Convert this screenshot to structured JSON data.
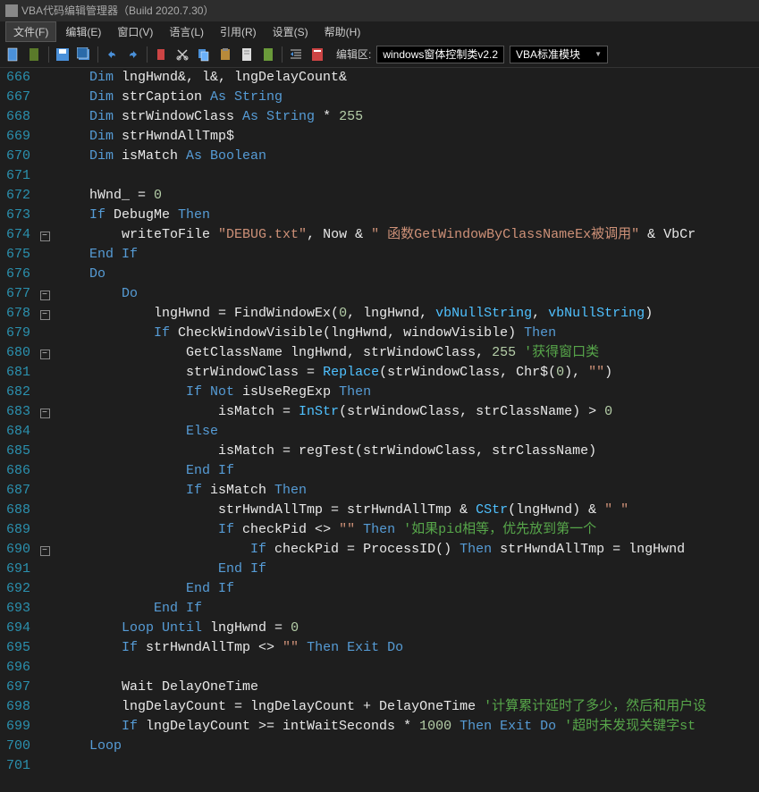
{
  "title": "VBA代码编辑管理器（Build 2020.7.30）",
  "menu": {
    "file": "文件(F)",
    "edit": "编辑(E)",
    "window": "窗口(V)",
    "language": "语言(L)",
    "reference": "引用(R)",
    "settings": "设置(S)",
    "help": "帮助(H)"
  },
  "toolbar": {
    "editarea_label": "编辑区:",
    "combo1": "windows窗体控制类v2.2",
    "combo2": "VBA标准模块"
  },
  "lines": [
    "666",
    "667",
    "668",
    "669",
    "670",
    "671",
    "672",
    "673",
    "674",
    "675",
    "676",
    "677",
    "678",
    "679",
    "680",
    "681",
    "682",
    "683",
    "684",
    "685",
    "686",
    "687",
    "688",
    "689",
    "690",
    "691",
    "692",
    "693",
    "694",
    "695",
    "696",
    "697",
    "698",
    "699",
    "700",
    "701"
  ],
  "code": [
    [
      [
        "kw",
        "    Dim"
      ],
      [
        "id",
        " lngHwnd&, l&, lngDelayCount&"
      ]
    ],
    [
      [
        "kw",
        "    Dim"
      ],
      [
        "id",
        " strCaption "
      ],
      [
        "kw",
        "As String"
      ]
    ],
    [
      [
        "kw",
        "    Dim"
      ],
      [
        "id",
        " strWindowClass "
      ],
      [
        "kw",
        "As String"
      ],
      [
        "op",
        " * "
      ],
      [
        "num",
        "255"
      ]
    ],
    [
      [
        "kw",
        "    Dim"
      ],
      [
        "id",
        " strHwndAllTmp$"
      ]
    ],
    [
      [
        "kw",
        "    Dim"
      ],
      [
        "id",
        " isMatch "
      ],
      [
        "kw",
        "As Boolean"
      ]
    ],
    [
      [
        "id",
        ""
      ]
    ],
    [
      [
        "id",
        "    hWnd_ = "
      ],
      [
        "num",
        "0"
      ]
    ],
    [
      [
        "kw",
        "    If"
      ],
      [
        "id",
        " DebugMe "
      ],
      [
        "kw",
        "Then"
      ]
    ],
    [
      [
        "id",
        "        writeToFile "
      ],
      [
        "str",
        "\"DEBUG.txt\""
      ],
      [
        "id",
        ", Now & "
      ],
      [
        "str",
        "\" 函数GetWindowByClassNameEx被调用\""
      ],
      [
        "id",
        " & VbCr"
      ]
    ],
    [
      [
        "kw",
        "    End If"
      ]
    ],
    [
      [
        "kw",
        "    Do"
      ]
    ],
    [
      [
        "kw",
        "        Do"
      ]
    ],
    [
      [
        "id",
        "            lngHwnd = FindWindowEx("
      ],
      [
        "num",
        "0"
      ],
      [
        "id",
        ", lngHwnd, "
      ],
      [
        "fn",
        "vbNullString"
      ],
      [
        "id",
        ", "
      ],
      [
        "fn",
        "vbNullString"
      ],
      [
        "id",
        ")"
      ]
    ],
    [
      [
        "kw",
        "            If"
      ],
      [
        "id",
        " CheckWindowVisible(lngHwnd, windowVisible) "
      ],
      [
        "kw",
        "Then"
      ]
    ],
    [
      [
        "id",
        "                GetClassName lngHwnd, strWindowClass, "
      ],
      [
        "num",
        "255 "
      ],
      [
        "cmt",
        "'获得窗口类"
      ]
    ],
    [
      [
        "id",
        "                strWindowClass = "
      ],
      [
        "fn",
        "Replace"
      ],
      [
        "id",
        "(strWindowClass, Chr$("
      ],
      [
        "num",
        "0"
      ],
      [
        "id",
        "), "
      ],
      [
        "str",
        "\"\""
      ],
      [
        "id",
        ")"
      ]
    ],
    [
      [
        "kw",
        "                If Not"
      ],
      [
        "id",
        " isUseRegExp "
      ],
      [
        "kw",
        "Then"
      ]
    ],
    [
      [
        "id",
        "                    isMatch = "
      ],
      [
        "fn",
        "InStr"
      ],
      [
        "id",
        "(strWindowClass, strClassName) > "
      ],
      [
        "num",
        "0"
      ]
    ],
    [
      [
        "kw",
        "                Else"
      ]
    ],
    [
      [
        "id",
        "                    isMatch = regTest(strWindowClass, strClassName)"
      ]
    ],
    [
      [
        "kw",
        "                End If"
      ]
    ],
    [
      [
        "kw",
        "                If"
      ],
      [
        "id",
        " isMatch "
      ],
      [
        "kw",
        "Then"
      ]
    ],
    [
      [
        "id",
        "                    strHwndAllTmp = strHwndAllTmp & "
      ],
      [
        "fn",
        "CStr"
      ],
      [
        "id",
        "(lngHwnd) & "
      ],
      [
        "str",
        "\" \""
      ]
    ],
    [
      [
        "kw",
        "                    If"
      ],
      [
        "id",
        " checkPid <> "
      ],
      [
        "str",
        "\"\""
      ],
      [
        "kw",
        " Then "
      ],
      [
        "cmt",
        "'如果pid相等，优先放到第一个"
      ]
    ],
    [
      [
        "kw",
        "                        If"
      ],
      [
        "id",
        " checkPid = ProcessID() "
      ],
      [
        "kw",
        "Then"
      ],
      [
        "id",
        " strHwndAllTmp = lngHwnd"
      ]
    ],
    [
      [
        "kw",
        "                    End If"
      ]
    ],
    [
      [
        "kw",
        "                End If"
      ]
    ],
    [
      [
        "kw",
        "            End If"
      ]
    ],
    [
      [
        "kw",
        "        Loop Until"
      ],
      [
        "id",
        " lngHwnd = "
      ],
      [
        "num",
        "0"
      ]
    ],
    [
      [
        "kw",
        "        If"
      ],
      [
        "id",
        " strHwndAllTmp <> "
      ],
      [
        "str",
        "\"\""
      ],
      [
        "kw",
        " Then Exit Do"
      ]
    ],
    [
      [
        "id",
        ""
      ]
    ],
    [
      [
        "id",
        "        Wait DelayOneTime"
      ]
    ],
    [
      [
        "id",
        "        lngDelayCount = lngDelayCount + DelayOneTime "
      ],
      [
        "cmt",
        "'计算累计延时了多少，然后和用户设"
      ]
    ],
    [
      [
        "kw",
        "        If"
      ],
      [
        "id",
        " lngDelayCount >= intWaitSeconds * "
      ],
      [
        "num",
        "1000"
      ],
      [
        "kw",
        " Then Exit Do "
      ],
      [
        "cmt",
        "'超时未发现关键字st"
      ]
    ],
    [
      [
        "kw",
        "    Loop"
      ]
    ],
    [
      [
        "id",
        ""
      ]
    ]
  ],
  "folds": {
    "8": "-",
    "11": "-",
    "12": "-",
    "14": "-",
    "17": "-",
    "24": "-"
  },
  "chart_data": null
}
